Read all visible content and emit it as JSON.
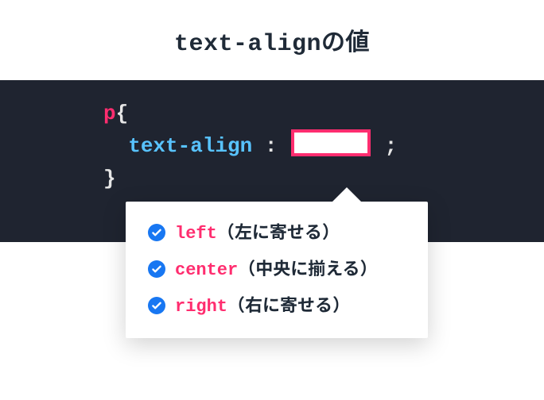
{
  "title": "text-alignの値",
  "code": {
    "selector": "p",
    "brace_open": "{",
    "indent": "  ",
    "property": "text-align",
    "colon": " : ",
    "semicolon": " ;",
    "brace_close": "}"
  },
  "options": [
    {
      "value": "left",
      "desc": "（左に寄せる）"
    },
    {
      "value": "center",
      "desc": "（中央に揃える）"
    },
    {
      "value": "right",
      "desc": "（右に寄せる）"
    }
  ]
}
